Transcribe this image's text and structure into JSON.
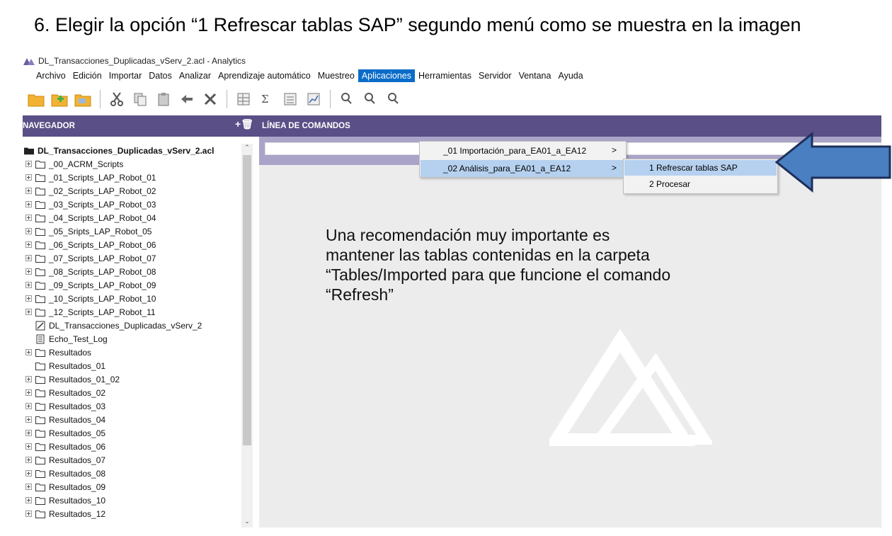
{
  "instruction": "6. Elegir la opción “1 Refrescar tablas SAP” segundo menú como se muestra en la imagen",
  "window": {
    "title": "DL_Transacciones_Duplicadas_vServ_2.acl - Analytics"
  },
  "menubar": [
    "Archivo",
    "Edición",
    "Importar",
    "Datos",
    "Analizar",
    "Aprendizaje automático",
    "Muestreo",
    "Aplicaciones",
    "Herramientas",
    "Servidor",
    "Ventana",
    "Ayuda"
  ],
  "menubar_active": "Aplicaciones",
  "applications_menu": [
    {
      "label": "_01 Importación_para_EA01_a_EA12",
      "arrow": ">"
    },
    {
      "label": "_02 Análisis_para_EA01_a_EA12",
      "arrow": ">"
    }
  ],
  "submenu": [
    "1 Refrescar tablas SAP",
    "2 Procesar"
  ],
  "navigator": {
    "header": "NAVEGADOR",
    "add_icon": "+🗑",
    "root": "DL_Transacciones_Duplicadas_vServ_2.acl",
    "items": [
      {
        "label": "_00_ACRM_Scripts",
        "type": "folder",
        "expandable": true
      },
      {
        "label": "_01_Scripts_LAP_Robot_01",
        "type": "folder",
        "expandable": true
      },
      {
        "label": "_02_Scripts_LAP_Robot_02",
        "type": "folder",
        "expandable": true
      },
      {
        "label": "_03_Scripts_LAP_Robot_03",
        "type": "folder",
        "expandable": true
      },
      {
        "label": "_04_Scripts_LAP_Robot_04",
        "type": "folder",
        "expandable": true
      },
      {
        "label": "_05_Sripts_LAP_Robot_05",
        "type": "folder",
        "expandable": true
      },
      {
        "label": "_06_Scripts_LAP_Robot_06",
        "type": "folder",
        "expandable": true
      },
      {
        "label": "_07_Scripts_LAP_Robot_07",
        "type": "folder",
        "expandable": true
      },
      {
        "label": "_08_Scripts_LAP_Robot_08",
        "type": "folder",
        "expandable": true
      },
      {
        "label": "_09_Scripts_LAP_Robot_09",
        "type": "folder",
        "expandable": true
      },
      {
        "label": "_10_Scripts_LAP_Robot_10",
        "type": "folder",
        "expandable": true
      },
      {
        "label": "_12_Scripts_LAP_Robot_11",
        "type": "folder",
        "expandable": true
      },
      {
        "label": "DL_Transacciones_Duplicadas_vServ_2",
        "type": "script",
        "expandable": false
      },
      {
        "label": "Echo_Test_Log",
        "type": "log",
        "expandable": false
      },
      {
        "label": "Resultados",
        "type": "folder",
        "expandable": true
      },
      {
        "label": "Resultados_01",
        "type": "folder",
        "expandable": false
      },
      {
        "label": "Resultados_01_02",
        "type": "folder",
        "expandable": true
      },
      {
        "label": "Resultados_02",
        "type": "folder",
        "expandable": true
      },
      {
        "label": "Resultados_03",
        "type": "folder",
        "expandable": true
      },
      {
        "label": "Resultados_04",
        "type": "folder",
        "expandable": true
      },
      {
        "label": "Resultados_05",
        "type": "folder",
        "expandable": true
      },
      {
        "label": "Resultados_06",
        "type": "folder",
        "expandable": true
      },
      {
        "label": "Resultados_07",
        "type": "folder",
        "expandable": true
      },
      {
        "label": "Resultados_08",
        "type": "folder",
        "expandable": true
      },
      {
        "label": "Resultados_09",
        "type": "folder",
        "expandable": true
      },
      {
        "label": "Resultados_10",
        "type": "folder",
        "expandable": true
      },
      {
        "label": "Resultados_12",
        "type": "folder",
        "expandable": true
      }
    ]
  },
  "command_line": {
    "header": "LÍNEA DE COMANDOS",
    "value": ""
  },
  "note_lines": [
    "Una recomendación muy importante es",
    "mantener las tablas contenidas en la carpeta",
    "“Tables/Imported para que funcione el comando",
    "“Refresh”"
  ],
  "colors": {
    "header": "#5a4f86",
    "menu_active": "#0a6cc8",
    "highlight": "#b6d1ef",
    "arrow": "#4a7fc1",
    "folder": "#e8a32b"
  }
}
